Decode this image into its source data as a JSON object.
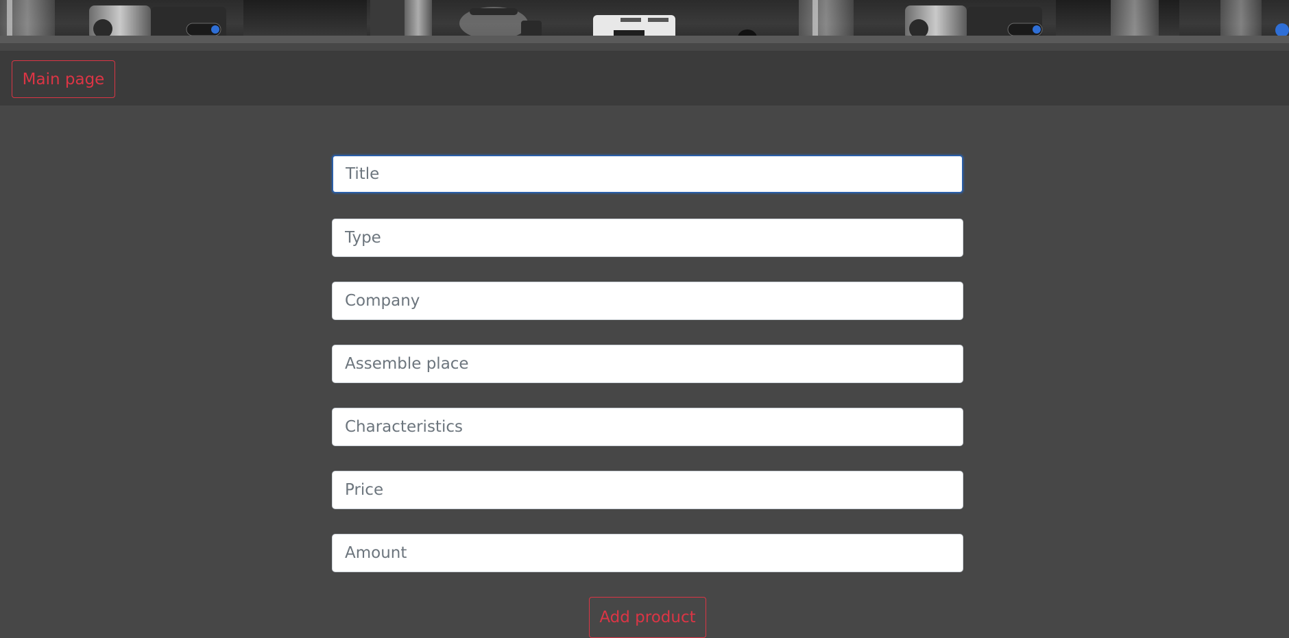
{
  "nav": {
    "main_page_label": "Main page"
  },
  "form": {
    "fields": [
      {
        "placeholder": "Title",
        "value": ""
      },
      {
        "placeholder": "Type",
        "value": ""
      },
      {
        "placeholder": "Company",
        "value": ""
      },
      {
        "placeholder": "Assemble place",
        "value": ""
      },
      {
        "placeholder": "Characteristics",
        "value": ""
      },
      {
        "placeholder": "Price",
        "value": ""
      },
      {
        "placeholder": "Amount",
        "value": ""
      }
    ],
    "submit_label": "Add product"
  },
  "colors": {
    "accent": "#dc3545",
    "page_background": "#474747",
    "navbar_background": "#3b3b3b",
    "focus_border": "#2b5fa8"
  }
}
